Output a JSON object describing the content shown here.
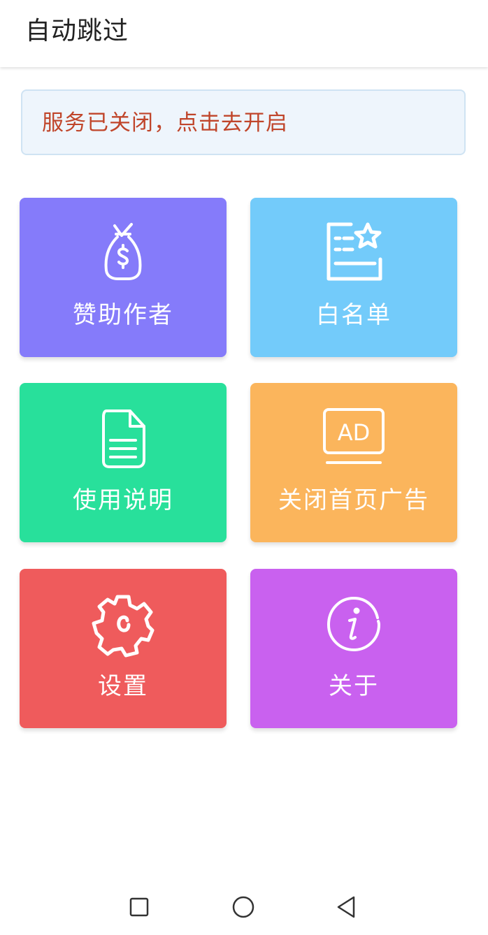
{
  "app_bar": {
    "title": "自动跳过"
  },
  "banner": {
    "text": "服务已关闭，点击去开启",
    "text_color": "#c0452a",
    "background": "#eef5fc"
  },
  "tiles": [
    {
      "label": "赞助作者",
      "icon": "money-bag-icon",
      "color": "#857bfa"
    },
    {
      "label": "白名单",
      "icon": "whitelist-star-icon",
      "color": "#73cbfa"
    },
    {
      "label": "使用说明",
      "icon": "document-icon",
      "color": "#28e09b"
    },
    {
      "label": "关闭首页广告",
      "icon": "ad-icon",
      "color": "#fbb55c"
    },
    {
      "label": "设置",
      "icon": "gear-icon",
      "color": "#ef5b5c"
    },
    {
      "label": "关于",
      "icon": "info-icon",
      "color": "#c961ef"
    }
  ],
  "ad_icon_text": "AD",
  "nav_bar": {
    "recent": "recent-apps-icon",
    "home": "home-icon",
    "back": "back-icon"
  }
}
